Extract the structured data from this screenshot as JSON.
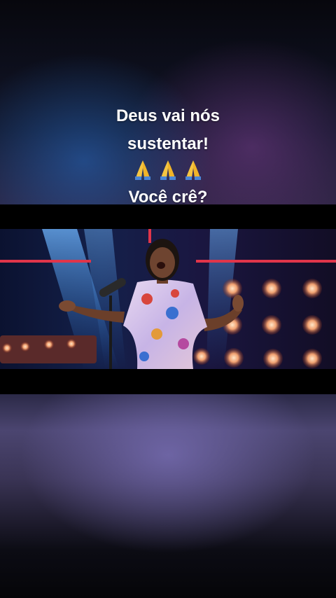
{
  "caption": {
    "line1": "Deus vai nós",
    "line2": "sustentar!",
    "emoji": "🙏🙏🙏",
    "line4": "Você crê?"
  },
  "video": {
    "scene": "singer-on-stage"
  },
  "icons": {
    "pray": "folded-hands-icon"
  },
  "colors": {
    "caption_text": "#ffffff",
    "stage_blue": "#2c7ad6",
    "stage_red": "#e0354a",
    "bulb_orange": "#f0a070"
  }
}
